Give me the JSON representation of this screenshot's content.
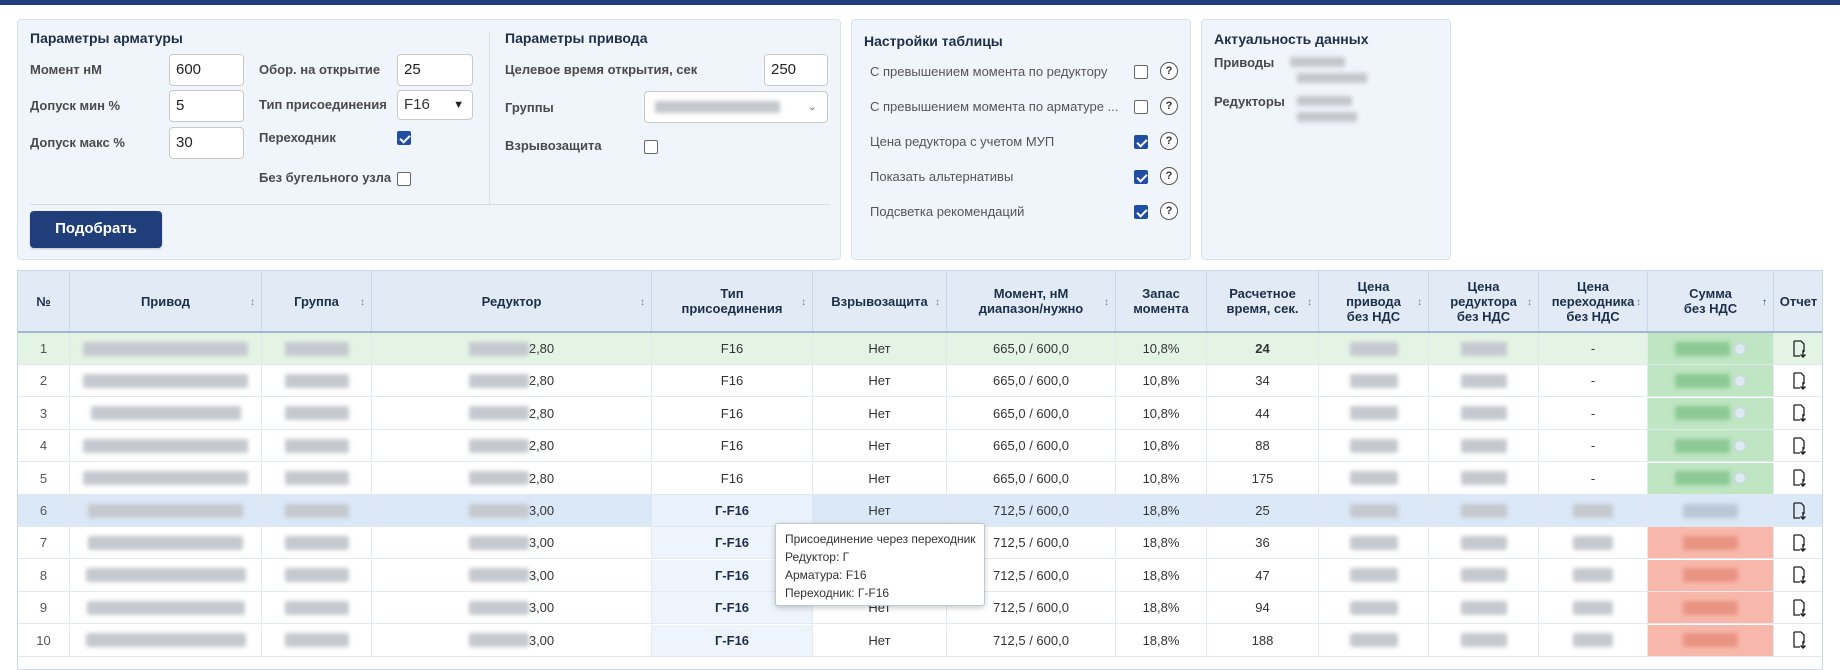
{
  "armature": {
    "title": "Параметры арматуры",
    "moment_label": "Момент нМ",
    "moment_value": "600",
    "tol_min_label": "Допуск мин %",
    "tol_min_value": "5",
    "tol_max_label": "Допуск макс %",
    "tol_max_value": "30",
    "turns_label": "Обор. на открытие",
    "turns_value": "25",
    "conn_type_label": "Тип присоединения",
    "conn_type_value": "F16",
    "adapter_label": "Переходник",
    "adapter_checked": true,
    "no_bracket_label": "Без бугельного узла",
    "no_bracket_checked": false,
    "select_button": "Подобрать"
  },
  "drive": {
    "title": "Параметры привода",
    "open_time_label": "Целевое время открытия, сек",
    "open_time_value": "250",
    "groups_label": "Группы",
    "explosion_label": "Взрывозащита",
    "explosion_checked": false
  },
  "table_settings": {
    "title": "Настройки таблицы",
    "help_icon_text": "?",
    "items": [
      {
        "label": "С превышением момента по редуктору",
        "checked": false
      },
      {
        "label": "С превышением момента по арматуре ...",
        "checked": false
      },
      {
        "label": "Цена редуктора с учетом МУП",
        "checked": true
      },
      {
        "label": "Показать альтернативы",
        "checked": true
      },
      {
        "label": "Подсветка рекомендаций",
        "checked": true
      }
    ]
  },
  "data_actuality": {
    "title": "Актуальность данных",
    "drives_label": "Приводы",
    "reducers_label": "Редукторы"
  },
  "table": {
    "columns": [
      "№",
      "Привод",
      "Группа",
      "Редуктор",
      "Тип присоединения",
      "Взрывозащита",
      "Момент, нМ диапазон/нужно",
      "Запас момента",
      "Расчетное время, сек.",
      "Цена привода без НДС",
      "Цена редуктора без НДС",
      "Цена переходника без НДС",
      "Сумма без НДС",
      "Отчет"
    ],
    "col_html": [
      "№",
      "Привод",
      "Группа",
      "Редуктор",
      "Тип<br>присоединения",
      "Взрывозащита",
      "Момент, нМ<br>диапазон/нужно",
      "Запас<br>момента",
      "Расчетное<br>время, сек.",
      "Цена<br>привода<br>без НДС",
      "Цена<br>редуктора<br>без НДС",
      "Цена<br>переходника<br>без НДС",
      "Сумма<br>без НДС",
      "Отчет"
    ],
    "rows": [
      {
        "n": "1",
        "reducer_suffix": "2,80",
        "conn": "F16",
        "ex": "Нет",
        "moment": "665,0 / 600,0",
        "reserve": "10,8%",
        "time": "24",
        "adapter_price": "-",
        "highlight": "green"
      },
      {
        "n": "2",
        "reducer_suffix": "2,80",
        "conn": "F16",
        "ex": "Нет",
        "moment": "665,0 / 600,0",
        "reserve": "10,8%",
        "time": "34",
        "adapter_price": "-",
        "highlight": ""
      },
      {
        "n": "3",
        "reducer_suffix": "2,80",
        "conn": "F16",
        "ex": "Нет",
        "moment": "665,0 / 600,0",
        "reserve": "10,8%",
        "time": "44",
        "adapter_price": "-",
        "highlight": ""
      },
      {
        "n": "4",
        "reducer_suffix": "2,80",
        "conn": "F16",
        "ex": "Нет",
        "moment": "665,0 / 600,0",
        "reserve": "10,8%",
        "time": "88",
        "adapter_price": "-",
        "highlight": ""
      },
      {
        "n": "5",
        "reducer_suffix": "2,80",
        "conn": "F16",
        "ex": "Нет",
        "moment": "665,0 / 600,0",
        "reserve": "10,8%",
        "time": "175",
        "adapter_price": "-",
        "highlight": ""
      },
      {
        "n": "6",
        "reducer_suffix": "3,00",
        "conn": "Г-F16",
        "ex": "Нет",
        "moment": "712,5 / 600,0",
        "reserve": "18,8%",
        "time": "25",
        "adapter_price": "",
        "highlight": "blue"
      },
      {
        "n": "7",
        "reducer_suffix": "3,00",
        "conn": "Г-F16",
        "ex": "Нет",
        "moment": "712,5 / 600,0",
        "reserve": "18,8%",
        "time": "36",
        "adapter_price": "",
        "highlight": ""
      },
      {
        "n": "8",
        "reducer_suffix": "3,00",
        "conn": "Г-F16",
        "ex": "Нет",
        "moment": "712,5 / 600,0",
        "reserve": "18,8%",
        "time": "47",
        "adapter_price": "",
        "highlight": ""
      },
      {
        "n": "9",
        "reducer_suffix": "3,00",
        "conn": "Г-F16",
        "ex": "Нет",
        "moment": "712,5 / 600,0",
        "reserve": "18,8%",
        "time": "94",
        "adapter_price": "",
        "highlight": ""
      },
      {
        "n": "10",
        "reducer_suffix": "3,00",
        "conn": "Г-F16",
        "ex": "Нет",
        "moment": "712,5 / 600,0",
        "reserve": "18,8%",
        "time": "188",
        "adapter_price": "",
        "highlight": ""
      }
    ]
  },
  "tooltip": {
    "line1": "Присоединение через переходник",
    "line2": "Редуктор: Г",
    "line3": "Арматура: F16",
    "line4": "Переходник: Г-F16"
  },
  "colors": {
    "accent": "#1f3e7a",
    "row_green": "#e3f4e4",
    "row_blue": "#dbe8f7",
    "sum_green": "#bfe5c3",
    "sum_red": "#f7b8ab"
  }
}
